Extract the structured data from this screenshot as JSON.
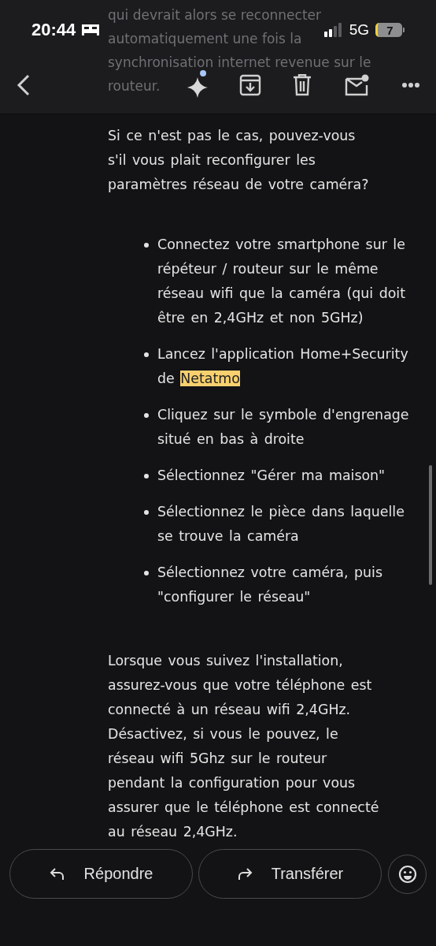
{
  "status_bar": {
    "time": "20:44",
    "network": "5G",
    "battery": "7",
    "low_battery": true
  },
  "toolbar": {
    "assistant_badge": true,
    "mail_badge": true
  },
  "faded_text": [
    "qui devrait alors se reconnecter",
    "automatiquement une fois la",
    "synchronisation internet revenue sur le",
    "routeur."
  ],
  "intro": "Si ce n'est pas le cas, pouvez-vous s'il vous plait reconfigurer les paramètres réseau de votre caméra?",
  "steps": [
    {
      "text": "Connectez votre smartphone sur le répéteur / routeur sur le même réseau wifi que la caméra (qui doit être en 2,4GHz et non 5GHz)"
    },
    {
      "text": "Lancez l'application Home+Security de ",
      "highlight": "Netatmo"
    },
    {
      "text": "Cliquez sur le symbole d'engrenage situé en bas à droite"
    },
    {
      "text": "Sélectionnez \"Gérer ma maison\""
    },
    {
      "text": "Sélectionnez le pièce dans laquelle se trouve la caméra"
    },
    {
      "text": "Sélectionnez votre caméra, puis \"configurer le réseau\""
    }
  ],
  "outro": "Lorsque vous suivez l'installation, assurez-vous que votre téléphone est connecté à un réseau wifi 2,4GHz. Désactivez, si vous le pouvez, le réseau wifi 5Ghz sur le routeur pendant la configuration pour vous assurer que le téléphone est connecté au réseau 2,4GHz.",
  "actions": [
    {
      "kind": "reply",
      "label": "Répondre"
    },
    {
      "kind": "forward",
      "label": "Transférer"
    }
  ]
}
